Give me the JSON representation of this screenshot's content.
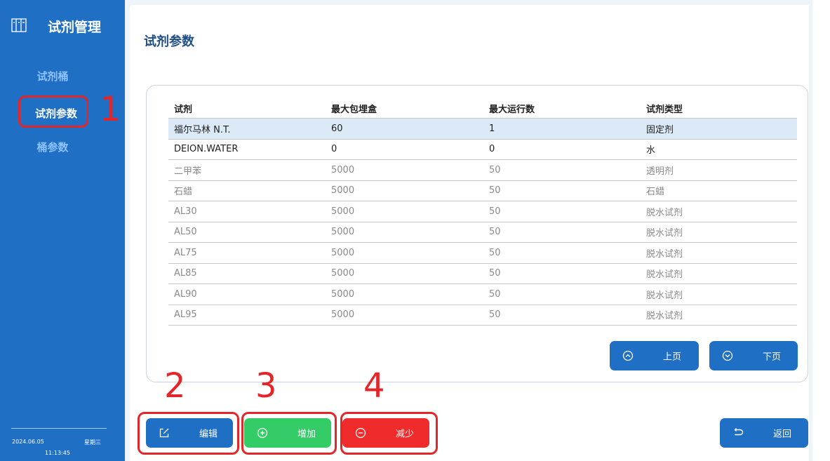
{
  "sidebar": {
    "app_title": "试剂管理",
    "items": [
      {
        "label": "试剂桶"
      },
      {
        "label": "试剂参数"
      },
      {
        "label": "桶参数"
      }
    ],
    "date": "2024.06.05",
    "weekday": "星期三",
    "time": "11:13:45",
    "colors": {
      "background": "#1f6fc4",
      "inactive_text": "#8ec2ff"
    }
  },
  "main": {
    "title": "试剂参数",
    "table": {
      "columns": [
        "试剂",
        "最大包埋盒",
        "最大运行数",
        "试剂类型"
      ],
      "rows": [
        [
          "福尔马林 N.T.",
          "60",
          "1",
          "固定剂"
        ],
        [
          "DEION.WATER",
          "0",
          "0",
          "水"
        ],
        [
          "二甲苯",
          "5000",
          "50",
          "透明剂"
        ],
        [
          "石蜡",
          "5000",
          "50",
          "石蜡"
        ],
        [
          "AL30",
          "5000",
          "50",
          "脱水试剂"
        ],
        [
          "AL50",
          "5000",
          "50",
          "脱水试剂"
        ],
        [
          "AL75",
          "5000",
          "50",
          "脱水试剂"
        ],
        [
          "AL85",
          "5000",
          "50",
          "脱水试剂"
        ],
        [
          "AL90",
          "5000",
          "50",
          "脱水试剂"
        ],
        [
          "AL95",
          "5000",
          "50",
          "脱水试剂"
        ]
      ]
    },
    "pager": {
      "prev_label": "上页",
      "next_label": "下页"
    },
    "actions": {
      "edit_label": "编辑",
      "add_label": "增加",
      "reduce_label": "减少",
      "back_label": "返回"
    }
  },
  "callouts": [
    "1",
    "2",
    "3",
    "4"
  ],
  "colors": {
    "primary": "#1f6fc4",
    "add": "#33cc66",
    "reduce": "#f02b2b",
    "annotation": "#e3262a"
  }
}
